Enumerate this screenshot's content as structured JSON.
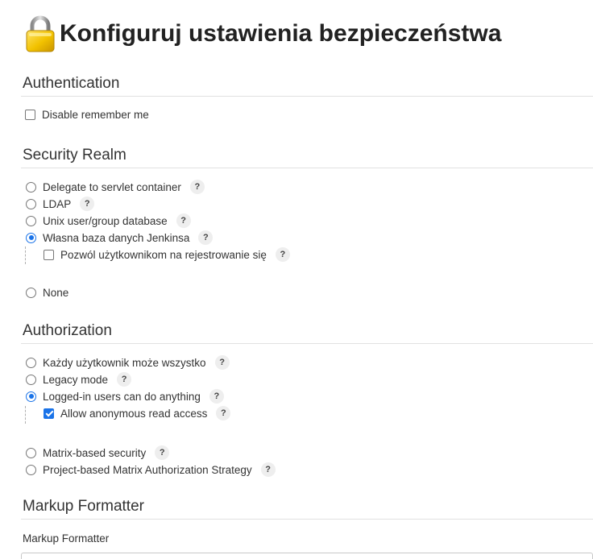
{
  "page": {
    "title": "Konfiguruj ustawienia bezpieczeństwa",
    "title_icon": "lock-icon"
  },
  "colors": {
    "accent": "#1a73e8",
    "text": "#333333",
    "divider": "#e1e1e1",
    "help_badge_bg": "#eeeeee",
    "lock_gold": "#e8b400"
  },
  "authentication": {
    "heading": "Authentication",
    "disable_remember_me": {
      "label": "Disable remember me",
      "checked": false
    }
  },
  "security_realm": {
    "heading": "Security Realm",
    "options": [
      {
        "label": "Delegate to servlet container",
        "checked": false,
        "help": "?"
      },
      {
        "label": "LDAP",
        "checked": false,
        "help": "?"
      },
      {
        "label": "Unix user/group database",
        "checked": false,
        "help": "?"
      },
      {
        "label": "Własna baza danych Jenkinsa",
        "checked": true,
        "help": "?"
      },
      {
        "label": "None",
        "checked": false
      }
    ],
    "allow_signup": {
      "label": "Pozwól użytkownikom na rejestrowanie się",
      "checked": false,
      "help": "?"
    }
  },
  "authorization": {
    "heading": "Authorization",
    "options": [
      {
        "label": "Każdy użytkownik może wszystko",
        "checked": false,
        "help": "?"
      },
      {
        "label": "Legacy mode",
        "checked": false,
        "help": "?"
      },
      {
        "label": "Logged-in users can do anything",
        "checked": true,
        "help": "?"
      },
      {
        "label": "Matrix-based security",
        "checked": false,
        "help": "?"
      },
      {
        "label": "Project-based Matrix Authorization Strategy",
        "checked": false,
        "help": "?"
      }
    ],
    "allow_anonymous_read": {
      "label": "Allow anonymous read access",
      "checked": true,
      "help": "?"
    }
  },
  "markup_formatter": {
    "heading": "Markup Formatter",
    "field_label": "Markup Formatter"
  }
}
